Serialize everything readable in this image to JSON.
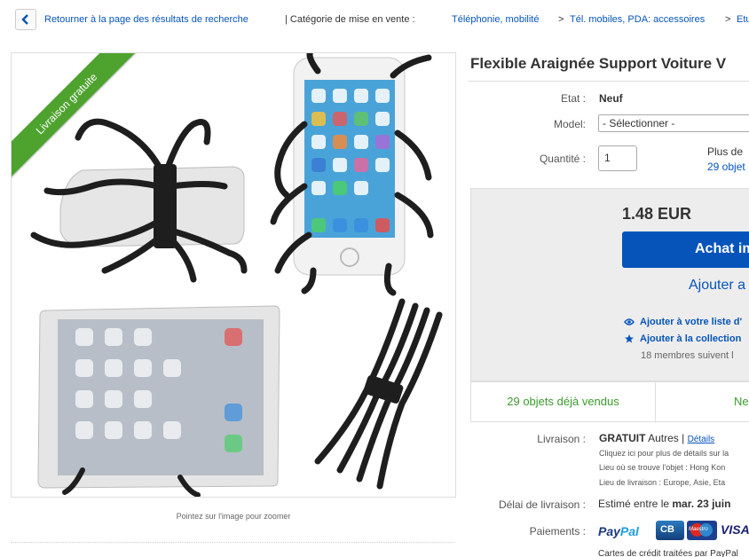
{
  "breadcrumb": {
    "back_label": "Retourner à la page des résultats de recherche",
    "category_prefix": "| Catégorie de mise en vente :",
    "cat1": "Téléphonie, mobilité",
    "sep": ">",
    "cat2": "Tél. mobiles, PDA: accessoires",
    "cat3": "Etu"
  },
  "gallery": {
    "ribbon": "Livraison gratuite",
    "zoom_hint": "Pointez sur l'image pour zoomer"
  },
  "listing": {
    "title": "Flexible Araignée Support Voiture V",
    "etat_label": "Etat :",
    "etat_value": "Neuf",
    "model_label": "Model:",
    "model_value": "- Sélectionner -",
    "qty_label": "Quantité :",
    "qty_value": "1",
    "stock_line1": "Plus de",
    "stock_line2": "29 objet"
  },
  "buybox": {
    "price": "1.48 EUR",
    "buy_label": "Achat im",
    "cart_label": "Ajouter a",
    "watch_label": "Ajouter à votre liste d'",
    "collection_label": "Ajouter à la collection",
    "members_text": "18 membres suivent l",
    "sold_text": "29 objets déjà vendus",
    "new_text": "Ne"
  },
  "shipping": {
    "label": "Livraison :",
    "free": "GRATUIT",
    "other": "Autres |",
    "details": "Détails",
    "note1": "Cliquez ici pour plus de détails sur la",
    "note2": "Lieu où se trouve l'objet : Hong Kon",
    "note3": "Lieu de livraison : Europe, Asie, Eta",
    "delay_label": "Délai de livraison :",
    "delay_prefix": "Estimé entre le",
    "delay_date": "mar. 23 juin"
  },
  "payment": {
    "label": "Paiements :",
    "paypal_pay": "Pay",
    "paypal_pal": "Pal",
    "cb": "CB",
    "maestro": "Maestro",
    "visa": "VISA",
    "note": "Cartes de crédit traitées par PayPal"
  },
  "colors": {
    "link": "#0654ba",
    "ribbon": "#4ea32f",
    "sold": "#3b9b2c"
  }
}
